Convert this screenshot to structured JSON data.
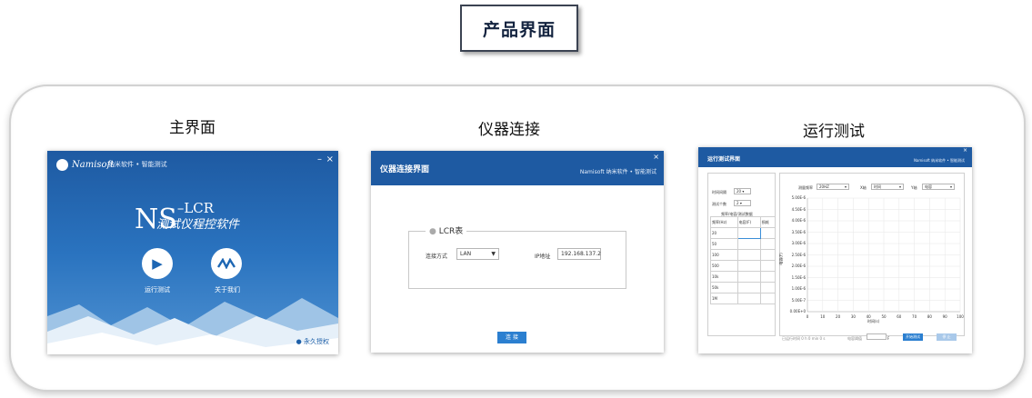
{
  "heading": "产品界面",
  "captions": {
    "main": "主界面",
    "connection": "仪器连接",
    "run": "运行测试"
  },
  "main_screen": {
    "logo": "Namisoft",
    "tagline": "纳米软件 • 智能测试",
    "minimize": "–",
    "close": "×",
    "product": "NS",
    "product_suffix": "LCR",
    "subtitle": "测试仪程控软件",
    "run_icon": "play-icon",
    "run_label": "运行测试",
    "about_icon": "namisoft-logo-icon",
    "about_label": "关于我们",
    "license_label": "永久授权"
  },
  "connection_screen": {
    "title": "仪器连接界面",
    "close": "×",
    "brand": "Namisoft 纳米软件 • 智能测试",
    "group_label": "LCR表",
    "method_label": "连接方式",
    "method_value": "LAN",
    "ip_label": "IP地址",
    "ip_value": "192.168.137.2",
    "confirm_label": "连 接"
  },
  "run_screen": {
    "title": "运行测试界面",
    "close": "×",
    "brand": "Namisoft 纳米软件 • 智能测试",
    "time_label": "时间间隔",
    "time_value": "20",
    "count_label": "测试个数",
    "count_value": "2",
    "table_title": "频率/电容/测试数据",
    "table_headers": [
      "频率(Hz)",
      "电容(F)",
      "损耗"
    ],
    "table_rows": [
      "20",
      "50",
      "100",
      "500",
      "10k",
      "50k",
      "1M"
    ],
    "freq_label": "测量频率",
    "freq_value": "20HZ",
    "x_label": "X轴",
    "x_value": "时间",
    "y_label": "Y轴",
    "y_value": "电容",
    "y_axis_title": "电容(F)",
    "x_axis_title": "时间(s)",
    "y_ticks": [
      "5.00E-6",
      "4.50E-6",
      "4.00E-6",
      "3.50E-6",
      "3.00E-6",
      "2.50E-6",
      "2.00E-6",
      "1.50E-6",
      "1.00E-6",
      "5.00E-7",
      "0.00E+0"
    ],
    "x_ticks": [
      "0",
      "10",
      "20",
      "30",
      "40",
      "50",
      "60",
      "70",
      "80",
      "90",
      "100"
    ],
    "status_text": "已运行时间 0 h 0 min 0 s",
    "limit_label": "电容阈值",
    "limit_unit": "F",
    "start_label": "开始测试",
    "stop_label": "停 止"
  }
}
